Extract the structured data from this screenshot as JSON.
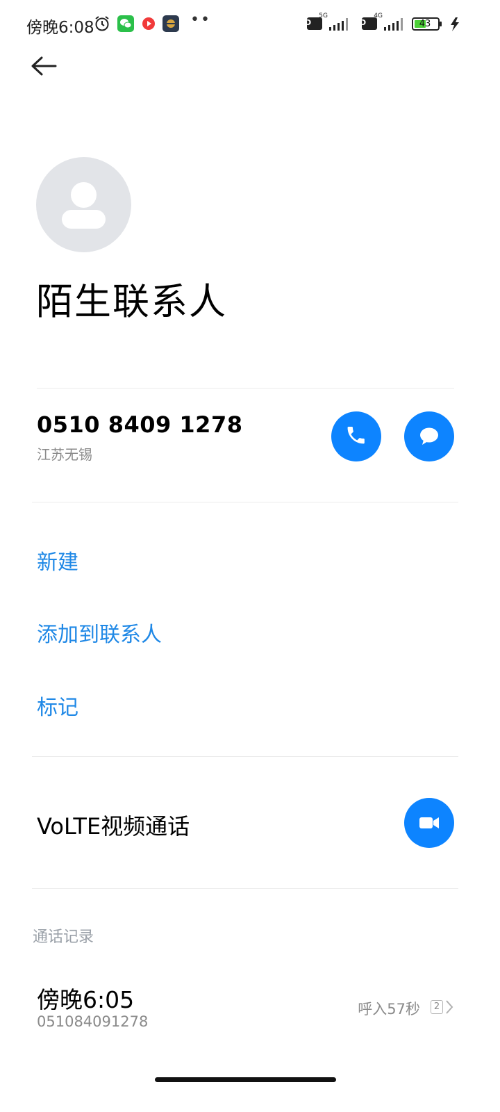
{
  "status_bar": {
    "time": "傍晚6:08",
    "icons": [
      "alarm-icon",
      "wechat-icon",
      "video-app-icon",
      "game-app-icon"
    ],
    "signal1_hd": "HD",
    "signal1_type": "5G",
    "signal2_hd": "HD",
    "signal2_type": "4G",
    "battery": "43"
  },
  "contact": {
    "name": "陌生联系人",
    "phone": "0510 8409 1278",
    "location": "江苏无锡"
  },
  "actions": {
    "new": "新建",
    "add_to_contacts": "添加到联系人",
    "mark": "标记"
  },
  "volte": {
    "label": "VoLTE视频通话"
  },
  "call_log": {
    "title": "通话记录",
    "entries": [
      {
        "time": "傍晚6:05",
        "number": "051084091278",
        "info": "呼入57秒",
        "count": "2"
      }
    ]
  },
  "colors": {
    "accent": "#0d84ff",
    "link": "#1f88e6",
    "battery_fill": "#4cd137"
  }
}
